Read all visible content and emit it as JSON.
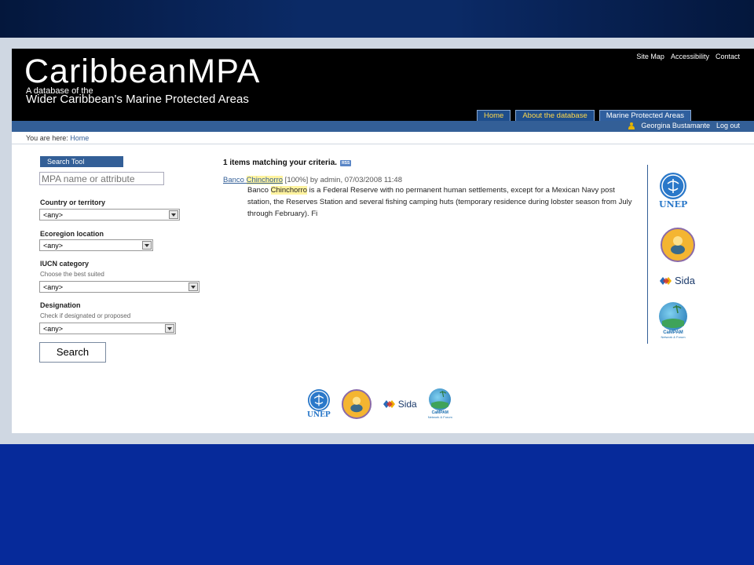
{
  "site": {
    "logo_title": "CaribbeanMPA",
    "logo_sub1": "A database of the",
    "logo_sub2": "Wider Caribbean's Marine Protected Areas"
  },
  "toplinks": [
    "Site Map",
    "Accessibility",
    "Contact"
  ],
  "tabs": [
    {
      "label": "Home",
      "active": false
    },
    {
      "label": "About the database",
      "active": false
    },
    {
      "label": "Marine Protected Areas",
      "active": true
    }
  ],
  "user": {
    "name": "Georgina Bustamante",
    "logout": "Log out"
  },
  "breadcrumb": {
    "prefix": "You are here:",
    "home": "Home"
  },
  "search_tool": {
    "header": "Search Tool",
    "placeholder": "MPA name or attribute",
    "country_label": "Country or territory",
    "country_value": "<any>",
    "ecoregion_label": "Ecoregion location",
    "ecoregion_value": "<any>",
    "iucn_label": "IUCN category",
    "iucn_help": "Choose the best suited",
    "iucn_value": "<any>",
    "designation_label": "Designation",
    "designation_help": "Check if designated or proposed",
    "designation_value": "<any>",
    "search_button": "Search"
  },
  "results": {
    "heading": "1 items matching your criteria.",
    "rss_label": "RSS",
    "item": {
      "title_a": "Banco ",
      "title_b": "Chinchorro",
      "meta": " [100%] by admin, 07/03/2008 11:48",
      "body_a": "Banco ",
      "body_b": "Chinchorro",
      "body_c": " is a Federal Reserve with no permanent human settlements, except for a Mexican Navy post station, the Reserves Station  and several fishing camping huts (temporary residence during lobster season from July through February). Fi"
    }
  },
  "partner_logos": {
    "unep": "UNEP",
    "sida": "Sida",
    "campam": "CaMPAM",
    "campam_sub": "Network & Forum"
  }
}
